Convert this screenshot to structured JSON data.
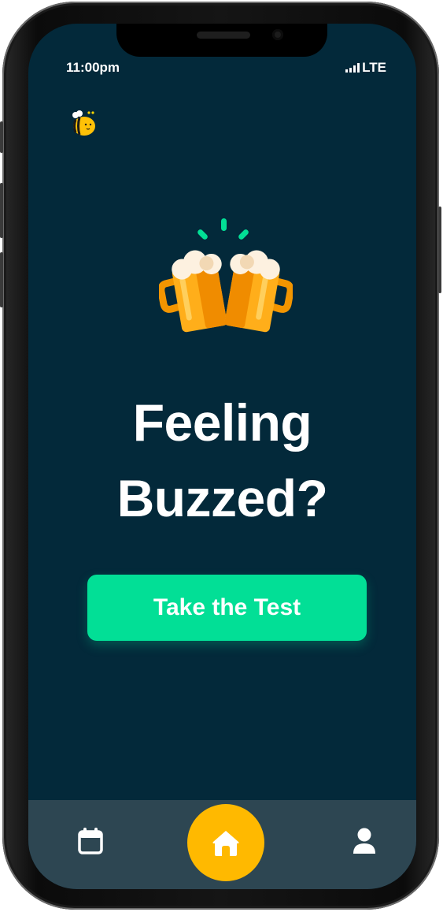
{
  "status_bar": {
    "time": "11:00pm",
    "network": "LTE",
    "signal_bars": 4
  },
  "app": {
    "logo_icon": "bee-logo-icon",
    "hero_icon": "beer-cheers-icon"
  },
  "main": {
    "headline_line1": "Feeling",
    "headline_line2": "Buzzed?",
    "cta_label": "Take the Test"
  },
  "tab_bar": {
    "items": [
      {
        "icon": "calendar-icon",
        "active": false
      },
      {
        "icon": "home-icon",
        "active": true
      },
      {
        "icon": "profile-icon",
        "active": false
      }
    ]
  },
  "colors": {
    "background": "#03293a",
    "accent_green": "#02df96",
    "accent_yellow": "#ffb900",
    "tab_bar": "#2d4652",
    "beer": "#ffae1a",
    "foam": "#fdf1e0"
  }
}
